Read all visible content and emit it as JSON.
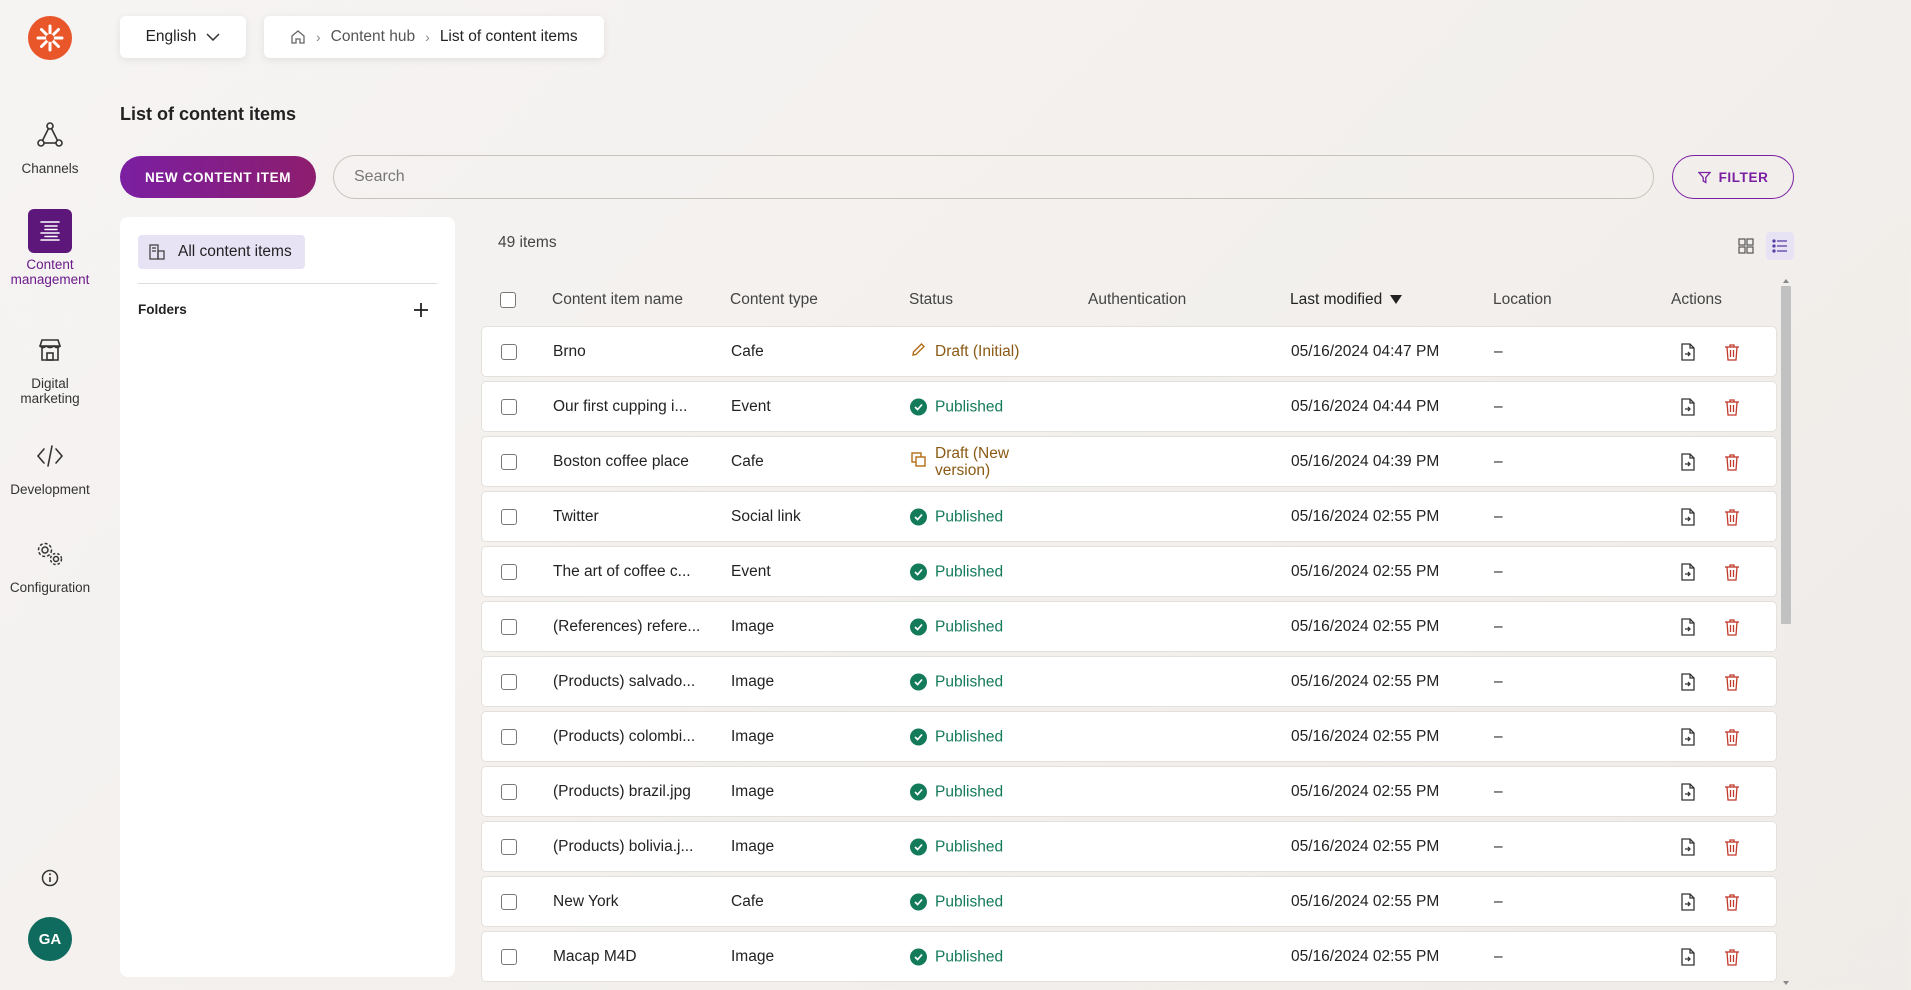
{
  "nav": {
    "items": [
      {
        "label": "Channels",
        "icon": "channels-icon"
      },
      {
        "label": "Content management",
        "icon": "content-management-icon"
      },
      {
        "label": "Digital marketing",
        "icon": "digital-marketing-icon"
      },
      {
        "label": "Development",
        "icon": "code-icon"
      },
      {
        "label": "Configuration",
        "icon": "gears-icon"
      }
    ],
    "avatar_initials": "GA"
  },
  "header": {
    "language": "English",
    "breadcrumb": [
      "Content hub",
      "List of content items"
    ]
  },
  "page": {
    "title": "List of content items",
    "new_button": "NEW CONTENT ITEM",
    "search_placeholder": "Search",
    "filter_button": "FILTER"
  },
  "folders": {
    "all_items": "All content items",
    "folders_label": "Folders"
  },
  "table": {
    "count": "49 items",
    "columns": [
      "Content item name",
      "Content type",
      "Status",
      "Authentication",
      "Last modified",
      "Location",
      "Actions"
    ],
    "sorted_by": "Last modified",
    "rows": [
      {
        "name": "Brno",
        "type": "Cafe",
        "status": "Draft (Initial)",
        "status_kind": "draft-initial",
        "modified": "05/16/2024 04:47 PM",
        "location": "–"
      },
      {
        "name": "Our first cupping i...",
        "type": "Event",
        "status": "Published",
        "status_kind": "published",
        "modified": "05/16/2024 04:44 PM",
        "location": "–"
      },
      {
        "name": "Boston coffee place",
        "type": "Cafe",
        "status": "Draft (New version)",
        "status_kind": "draft-new",
        "modified": "05/16/2024 04:39 PM",
        "location": "–"
      },
      {
        "name": "Twitter",
        "type": "Social link",
        "status": "Published",
        "status_kind": "published",
        "modified": "05/16/2024 02:55 PM",
        "location": "–"
      },
      {
        "name": "The art of coffee c...",
        "type": "Event",
        "status": "Published",
        "status_kind": "published",
        "modified": "05/16/2024 02:55 PM",
        "location": "–"
      },
      {
        "name": "(References) refere...",
        "type": "Image",
        "status": "Published",
        "status_kind": "published",
        "modified": "05/16/2024 02:55 PM",
        "location": "–"
      },
      {
        "name": "(Products) salvado...",
        "type": "Image",
        "status": "Published",
        "status_kind": "published",
        "modified": "05/16/2024 02:55 PM",
        "location": "–"
      },
      {
        "name": "(Products) colombi...",
        "type": "Image",
        "status": "Published",
        "status_kind": "published",
        "modified": "05/16/2024 02:55 PM",
        "location": "–"
      },
      {
        "name": "(Products) brazil.jpg",
        "type": "Image",
        "status": "Published",
        "status_kind": "published",
        "modified": "05/16/2024 02:55 PM",
        "location": "–"
      },
      {
        "name": "(Products) bolivia.j...",
        "type": "Image",
        "status": "Published",
        "status_kind": "published",
        "modified": "05/16/2024 02:55 PM",
        "location": "–"
      },
      {
        "name": "New York",
        "type": "Cafe",
        "status": "Published",
        "status_kind": "published",
        "modified": "05/16/2024 02:55 PM",
        "location": "–"
      },
      {
        "name": "Macap M4D",
        "type": "Image",
        "status": "Published",
        "status_kind": "published",
        "modified": "05/16/2024 02:55 PM",
        "location": "–"
      }
    ]
  },
  "colors": {
    "brand_purple": "#7b1fa2",
    "logo_orange": "#e8562a",
    "published_green": "#137a5a",
    "draft_amber": "#8a5a14",
    "delete_red": "#c0392b"
  }
}
